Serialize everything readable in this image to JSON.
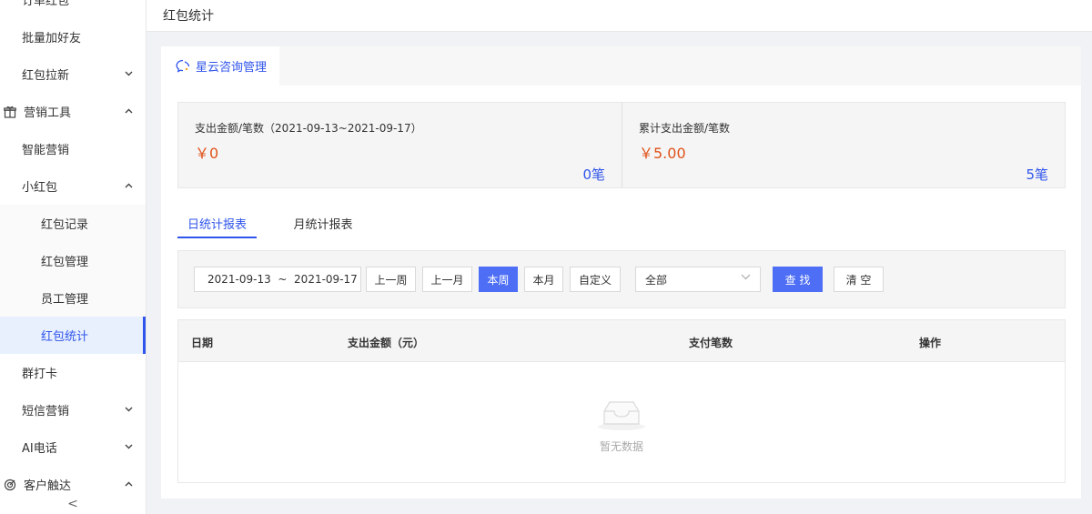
{
  "sidebar": {
    "items": [
      {
        "label": "订单红包",
        "level": 1,
        "chevron": ""
      },
      {
        "label": "批量加好友",
        "level": 1,
        "chevron": ""
      },
      {
        "label": "红包拉新",
        "level": 1,
        "chevron": "v"
      },
      {
        "label": "营销工具",
        "level": 0,
        "chevron": "^",
        "icon": "gift-icon"
      },
      {
        "label": "智能营销",
        "level": 1,
        "chevron": ""
      },
      {
        "label": "小红包",
        "level": 1,
        "chevron": "^"
      },
      {
        "label": "红包记录",
        "level": 2,
        "chevron": ""
      },
      {
        "label": "红包管理",
        "level": 2,
        "chevron": ""
      },
      {
        "label": "员工管理",
        "level": 2,
        "chevron": ""
      },
      {
        "label": "红包统计",
        "level": 2,
        "chevron": "",
        "active": true
      },
      {
        "label": "群打卡",
        "level": 1,
        "chevron": ""
      },
      {
        "label": "短信营销",
        "level": 1,
        "chevron": "v"
      },
      {
        "label": "AI电话",
        "level": 1,
        "chevron": "v"
      },
      {
        "label": "客户触达",
        "level": 0,
        "chevron": "^",
        "icon": "target-icon"
      }
    ],
    "collapse": "<"
  },
  "header": {
    "title": "红包统计"
  },
  "tab": {
    "label": "星云咨询管理",
    "icon": "chat-bubble-icon"
  },
  "stats": {
    "period": {
      "title": "支出金额/笔数（2021-09-13~2021-09-17）",
      "amount": "￥0",
      "count": "0笔"
    },
    "total": {
      "title": "累计支出金额/笔数",
      "amount": "￥5.00",
      "count": "5笔"
    }
  },
  "subtabs": {
    "daily": "日统计报表",
    "monthly": "月统计报表"
  },
  "filter": {
    "date_range": "2021-09-13  ~  2021-09-17",
    "buttons": {
      "last_week": "上一周",
      "last_month": "上一月",
      "this_week": "本周",
      "this_month": "本月",
      "custom": "自定义"
    },
    "select": "全部",
    "search": "查 找",
    "clear": "清 空"
  },
  "table": {
    "columns": {
      "date": "日期",
      "amount": "支出金额（元）",
      "count": "支付笔数",
      "ops": "操作"
    },
    "empty": "暂无数据"
  },
  "colors": {
    "accent": "#2f54eb",
    "amount": "#e0531b"
  }
}
